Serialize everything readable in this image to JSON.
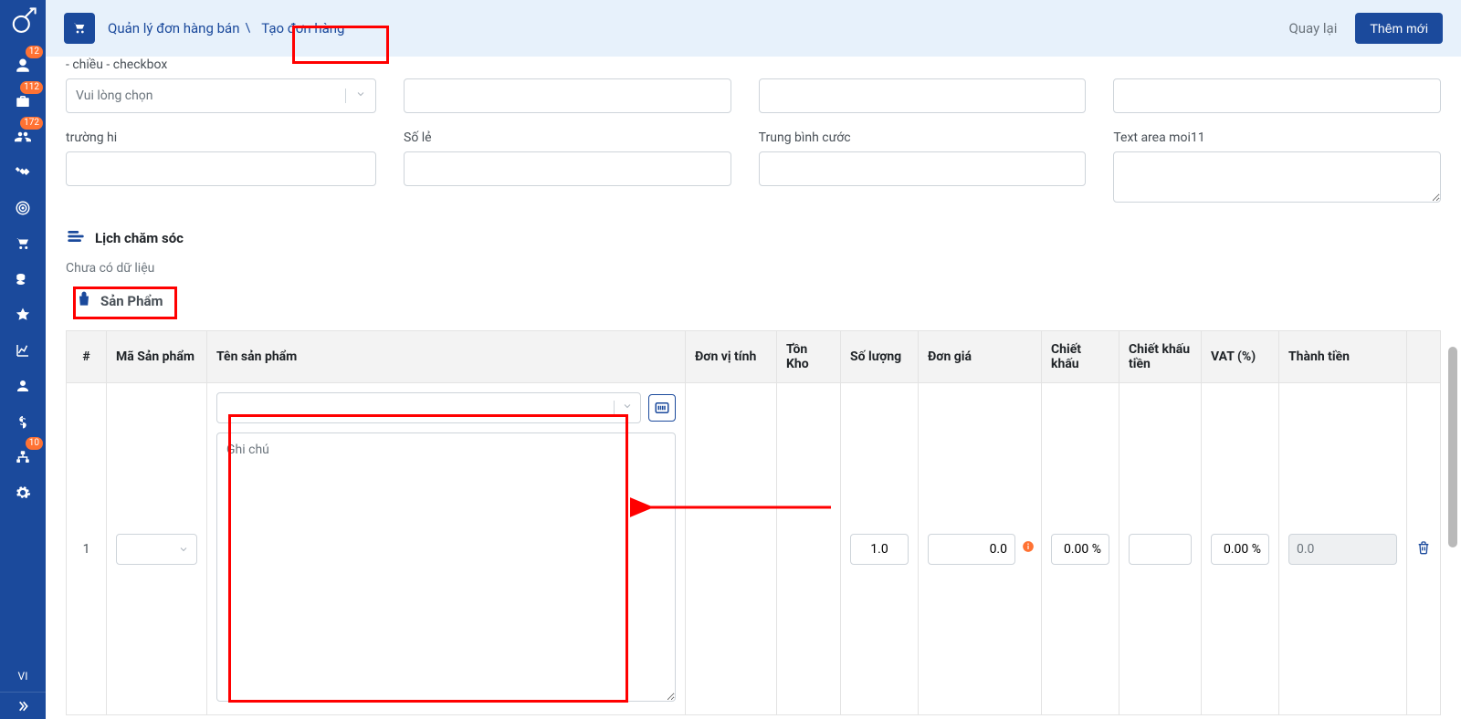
{
  "sidebar": {
    "badges": {
      "users": "12",
      "briefcase": "112",
      "group": "172",
      "org": "10"
    }
  },
  "header": {
    "breadcrumb_link": "Quản lý đơn hàng bán",
    "breadcrumb_separator": "\\",
    "tab_label": "Tạo đơn hàng",
    "back_label": "Quay lại",
    "new_label": "Thêm mới"
  },
  "form": {
    "row1": {
      "col1_label": "- chiều - checkbox",
      "col1_placeholder": "Vui lòng chọn"
    },
    "row2": {
      "c1_label": "trường hi",
      "c2_label": "Số lẻ",
      "c3_label": "Trung bình cước",
      "c4_label": "Text area moi11"
    }
  },
  "care": {
    "title": "Lịch chăm sóc",
    "empty": "Chưa có dữ liệu"
  },
  "products": {
    "title": "Sản Phẩm",
    "columns": {
      "idx": "#",
      "code": "Mã Sản phẩm",
      "name": "Tên sản phẩm",
      "unit": "Đơn vị tính",
      "stock": "Tồn Kho",
      "qty": "Số lượng",
      "price": "Đơn giá",
      "discount": "Chiết khấu",
      "discount_amount": "Chiết khấu tiền",
      "vat": "VAT (%)",
      "total": "Thành tiền"
    },
    "row": {
      "idx": "1",
      "qty": "1.0",
      "price": "0.0",
      "discount": "0.00 %",
      "discount_amount": "",
      "vat": "0.00 %",
      "total": "0.0",
      "notes_placeholder": "Ghi chú"
    }
  },
  "lang": "VI"
}
